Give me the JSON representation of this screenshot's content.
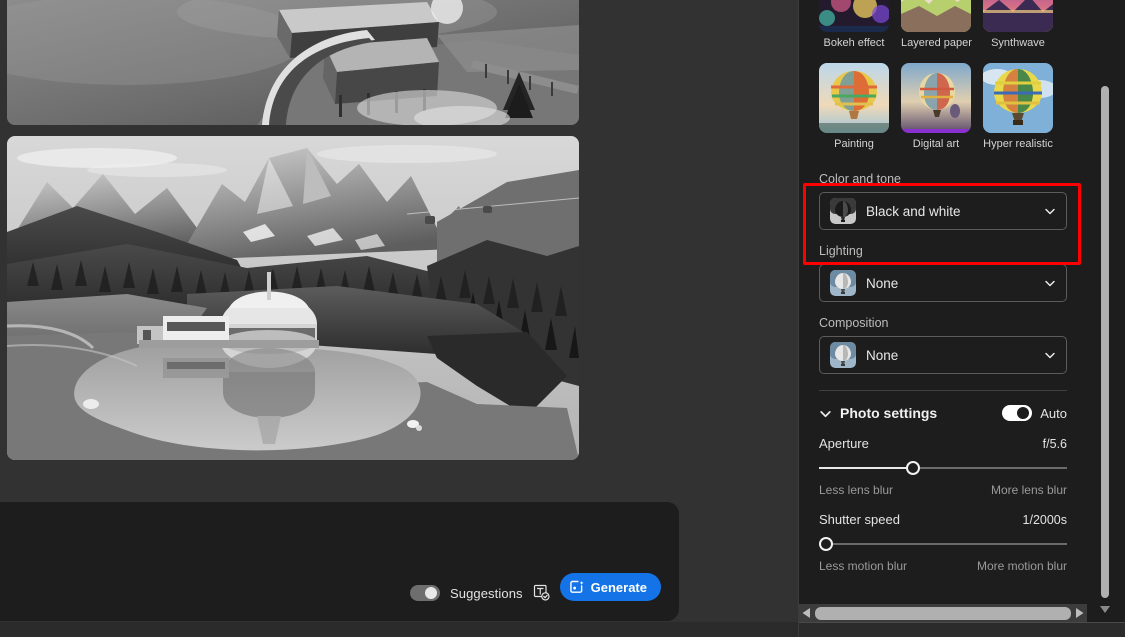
{
  "app": {
    "accent_blue": "#1473e6",
    "highlight_color": "#ff0000",
    "panel_bg": "#1d1d1d",
    "canvas_bg": "#323232"
  },
  "canvas": {
    "images": [
      {
        "name": "generated-image-top",
        "alt": "Black and white aerial photo of a lakeside wooden pavilion and dock"
      },
      {
        "name": "generated-image-main",
        "alt": "Black and white aerial photo of a mountain lake with dolomite peaks, pine forest and a domed circular building reflected in the water"
      }
    ]
  },
  "prompt_bar": {
    "suggestions_label": "Suggestions",
    "suggestions_enabled": false,
    "suggestions_icon": "text-suggestion-icon",
    "generate_label": "Generate",
    "generate_icon": "sparkle-generate-icon"
  },
  "styles": {
    "rows": [
      [
        {
          "label": "Bokeh effect",
          "icon": "style-thumb-bokeh"
        },
        {
          "label": "Layered paper",
          "icon": "style-thumb-layered-paper"
        },
        {
          "label": "Synthwave",
          "icon": "style-thumb-synthwave"
        }
      ],
      [
        {
          "label": "Painting",
          "icon": "style-thumb-painting"
        },
        {
          "label": "Digital art",
          "icon": "style-thumb-digital-art"
        },
        {
          "label": "Hyper realistic",
          "icon": "style-thumb-hyper-realistic"
        }
      ]
    ]
  },
  "effects": {
    "color_and_tone": {
      "label": "Color and tone",
      "value": "Black and white",
      "thumb_icon": "balloon-grayscale-icon",
      "chevron": "chevron-down-icon",
      "highlighted": true
    },
    "lighting": {
      "label": "Lighting",
      "value": "None",
      "thumb_icon": "balloon-blue-icon",
      "chevron": "chevron-down-icon"
    },
    "composition": {
      "label": "Composition",
      "value": "None",
      "thumb_icon": "balloon-blue-icon",
      "chevron": "chevron-down-icon"
    }
  },
  "photo_settings": {
    "title": "Photo settings",
    "collapse_icon": "chevron-down-icon",
    "auto_label": "Auto",
    "auto_enabled": true,
    "sliders": [
      {
        "name": "Aperture",
        "value": "f/5.6",
        "percent": 38,
        "min_label": "Less lens blur",
        "max_label": "More lens blur"
      },
      {
        "name": "Shutter speed",
        "value": "1/2000s",
        "percent": 0,
        "min_label": "Less motion blur",
        "max_label": "More motion blur"
      }
    ]
  },
  "scrollbars": {
    "vertical": {
      "thumb_top_pct": 14,
      "thumb_height_pct": 83,
      "down_icon": "caret-down-icon"
    },
    "horizontal": {
      "left_icon": "caret-left-icon",
      "right_icon": "caret-right-icon"
    }
  }
}
